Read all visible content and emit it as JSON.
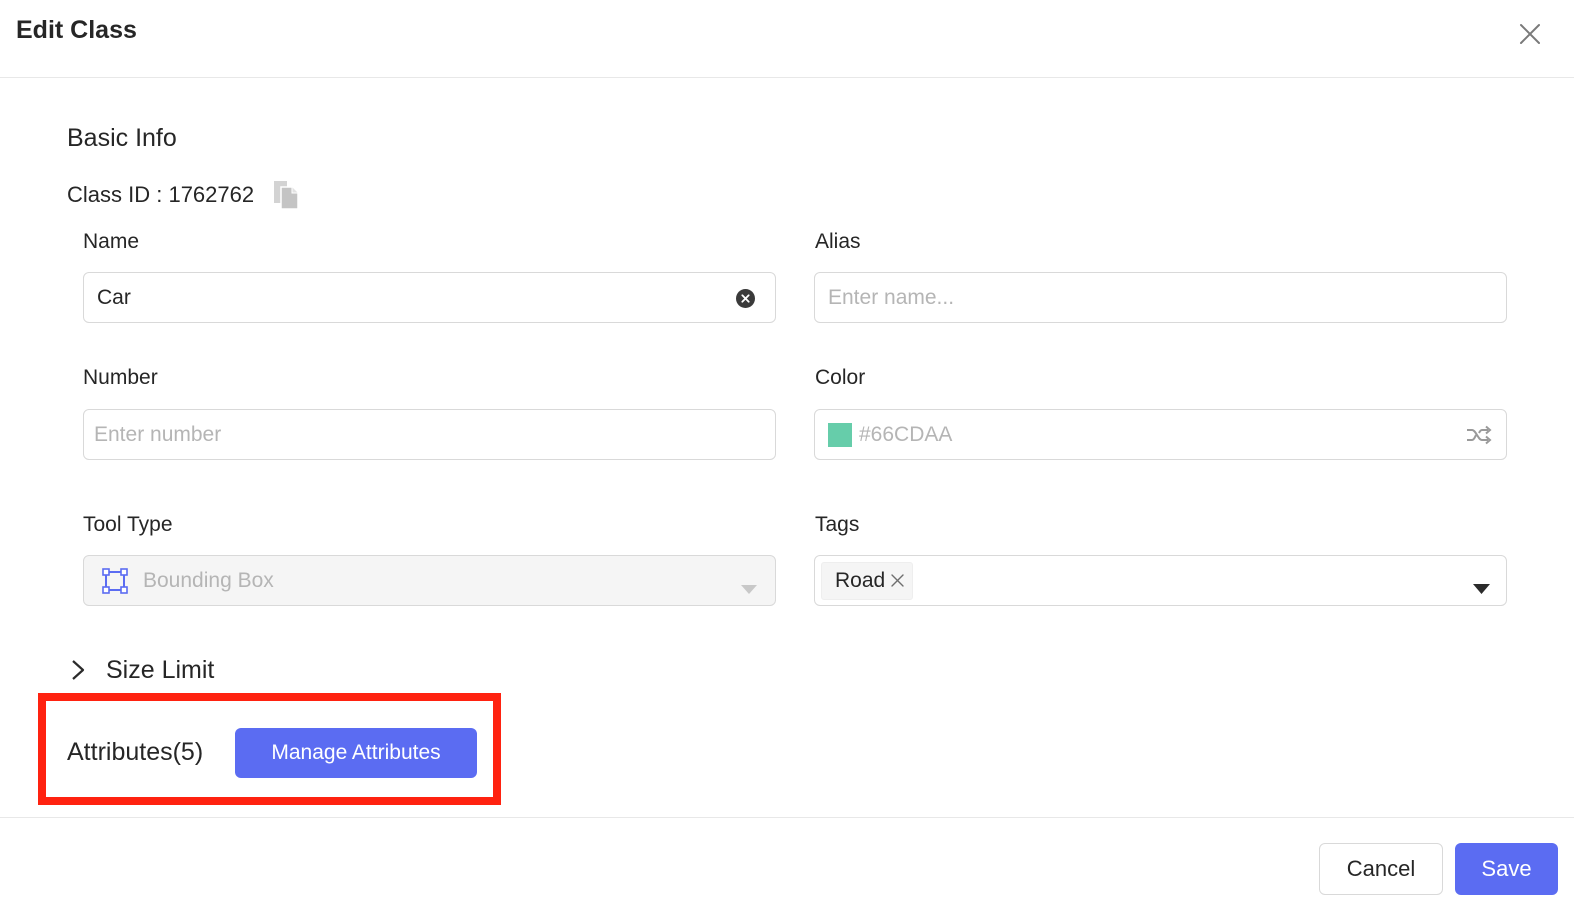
{
  "dialog": {
    "title": "Edit Class"
  },
  "basic_info": {
    "section_title": "Basic Info",
    "class_id_text": "Class ID : 1762762"
  },
  "fields": {
    "name": {
      "label": "Name",
      "value": "Car"
    },
    "alias": {
      "label": "Alias",
      "placeholder": "Enter name..."
    },
    "number": {
      "label": "Number",
      "placeholder": "Enter number"
    },
    "color": {
      "label": "Color",
      "value": "#66CDAA",
      "swatch": "#66CDAA"
    },
    "tool_type": {
      "label": "Tool Type",
      "value": "Bounding Box",
      "icon": "bounding-box-icon",
      "disabled": true
    },
    "tags": {
      "label": "Tags",
      "items": [
        "Road"
      ]
    }
  },
  "size_limit": {
    "label": "Size Limit",
    "expanded": false
  },
  "attributes": {
    "label": "Attributes(5)",
    "manage_label": "Manage Attributes"
  },
  "footer": {
    "cancel_label": "Cancel",
    "save_label": "Save"
  },
  "colors": {
    "primary": "#5B6CF2",
    "highlight_border": "#FF2210",
    "tool_icon": "#5B6CF2"
  },
  "icons": {
    "close": "close-icon",
    "copy": "copy-icon",
    "clear": "clear-circle-icon",
    "shuffle": "shuffle-icon",
    "dropdown": "caret-down-icon",
    "expand": "chevron-right-icon"
  }
}
